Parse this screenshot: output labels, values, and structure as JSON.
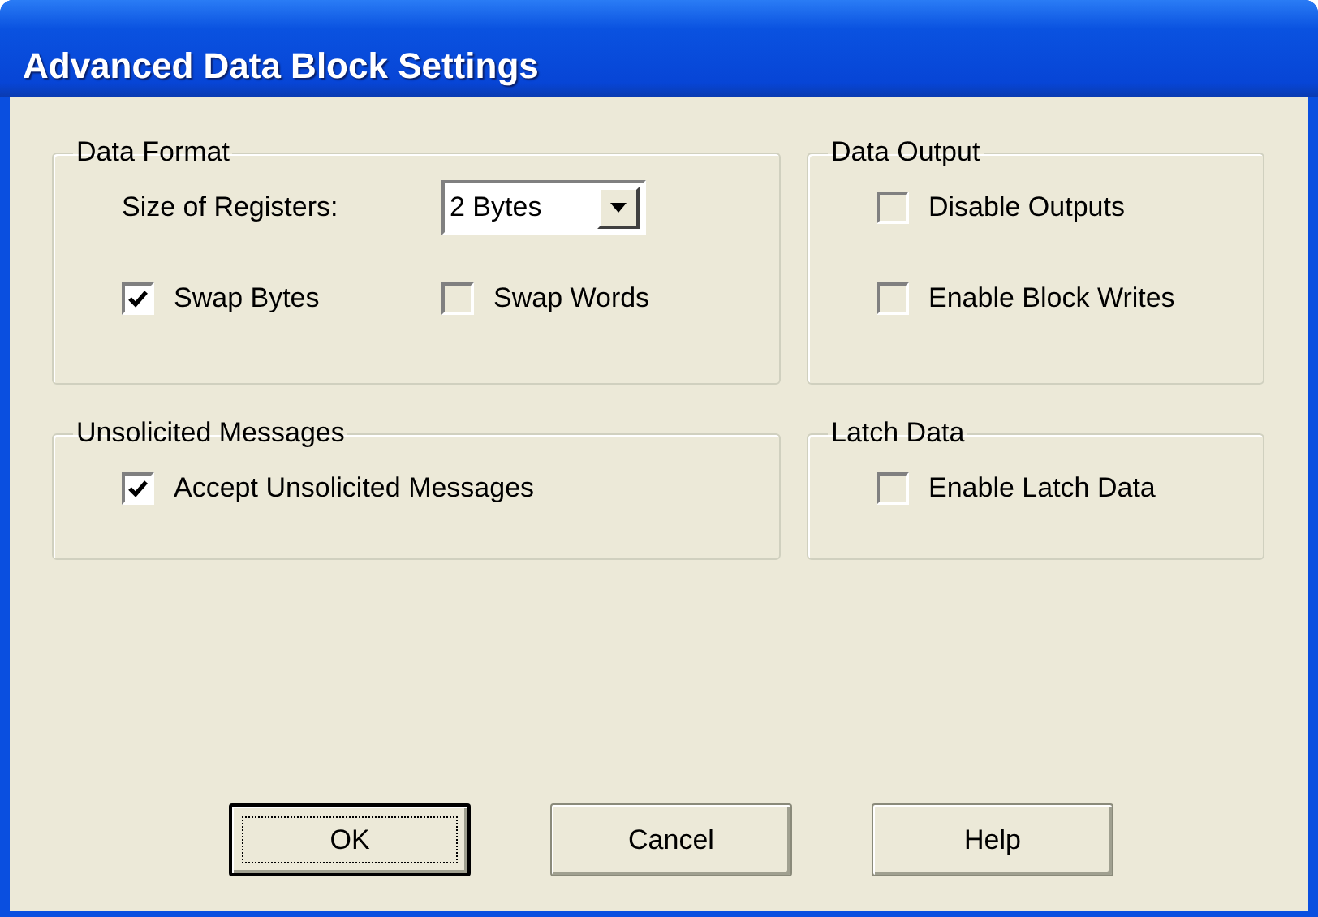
{
  "window": {
    "title": "Advanced Data Block Settings"
  },
  "groups": [
    {
      "title": "Data Format",
      "fields": [
        {
          "kind": "dropdown",
          "label": "Size of Registers:",
          "value": "2 Bytes"
        },
        {
          "kind": "checkboxes",
          "items": [
            {
              "label": "Swap Bytes",
              "checked": true
            },
            {
              "label": "Swap Words",
              "checked": false
            }
          ]
        }
      ]
    },
    {
      "title": "Data Output",
      "fields": [
        {
          "kind": "checkboxes",
          "items": [
            {
              "label": "Disable Outputs",
              "checked": false
            }
          ]
        },
        {
          "kind": "checkboxes",
          "items": [
            {
              "label": "Enable Block Writes",
              "checked": false
            }
          ]
        }
      ]
    },
    {
      "title": "Unsolicited Messages",
      "fields": [
        {
          "kind": "checkboxes",
          "items": [
            {
              "label": "Accept Unsolicited Messages",
              "checked": true
            }
          ]
        }
      ]
    },
    {
      "title": "Latch Data",
      "fields": [
        {
          "kind": "checkboxes",
          "items": [
            {
              "label": "Enable Latch Data",
              "checked": false
            }
          ]
        }
      ]
    }
  ],
  "buttons": [
    {
      "label": "OK",
      "default": true
    },
    {
      "label": "Cancel",
      "default": false
    },
    {
      "label": "Help",
      "default": false
    }
  ]
}
